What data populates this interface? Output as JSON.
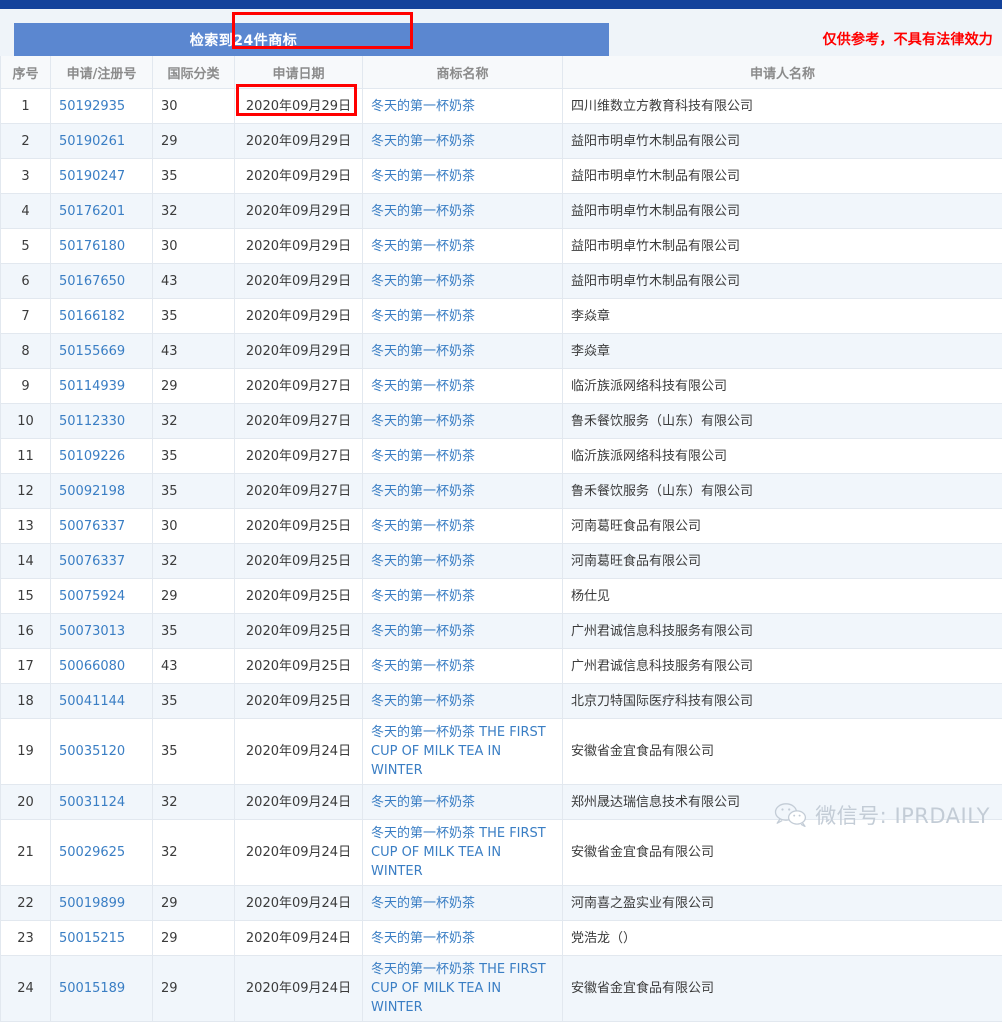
{
  "banner": {
    "count_text": "检索到24件商标",
    "disclaimer": "仅供参考，不具有法律效力",
    "bar_color": "#5b87d0",
    "disclaimer_color": "#ff0000",
    "highlight_color": "#ff0000"
  },
  "table": {
    "headers": {
      "seq": "序号",
      "number": "申请/注册号",
      "classification": "国际分类",
      "date": "申请日期",
      "trademark": "商标名称",
      "applicant": "申请人名称"
    },
    "rows": [
      {
        "seq": "1",
        "number": "50192935",
        "classification": "30",
        "date": "2020年09月29日",
        "trademark": "冬天的第一杯奶茶",
        "applicant": "四川维数立方教育科技有限公司"
      },
      {
        "seq": "2",
        "number": "50190261",
        "classification": "29",
        "date": "2020年09月29日",
        "trademark": "冬天的第一杯奶茶",
        "applicant": "益阳市明卓竹木制品有限公司"
      },
      {
        "seq": "3",
        "number": "50190247",
        "classification": "35",
        "date": "2020年09月29日",
        "trademark": "冬天的第一杯奶茶",
        "applicant": "益阳市明卓竹木制品有限公司"
      },
      {
        "seq": "4",
        "number": "50176201",
        "classification": "32",
        "date": "2020年09月29日",
        "trademark": "冬天的第一杯奶茶",
        "applicant": "益阳市明卓竹木制品有限公司"
      },
      {
        "seq": "5",
        "number": "50176180",
        "classification": "30",
        "date": "2020年09月29日",
        "trademark": "冬天的第一杯奶茶",
        "applicant": "益阳市明卓竹木制品有限公司"
      },
      {
        "seq": "6",
        "number": "50167650",
        "classification": "43",
        "date": "2020年09月29日",
        "trademark": "冬天的第一杯奶茶",
        "applicant": "益阳市明卓竹木制品有限公司"
      },
      {
        "seq": "7",
        "number": "50166182",
        "classification": "35",
        "date": "2020年09月29日",
        "trademark": "冬天的第一杯奶茶",
        "applicant": "李焱章"
      },
      {
        "seq": "8",
        "number": "50155669",
        "classification": "43",
        "date": "2020年09月29日",
        "trademark": "冬天的第一杯奶茶",
        "applicant": "李焱章"
      },
      {
        "seq": "9",
        "number": "50114939",
        "classification": "29",
        "date": "2020年09月27日",
        "trademark": "冬天的第一杯奶茶",
        "applicant": "临沂族派网络科技有限公司"
      },
      {
        "seq": "10",
        "number": "50112330",
        "classification": "32",
        "date": "2020年09月27日",
        "trademark": "冬天的第一杯奶茶",
        "applicant": "鲁禾餐饮服务（山东）有限公司"
      },
      {
        "seq": "11",
        "number": "50109226",
        "classification": "35",
        "date": "2020年09月27日",
        "trademark": "冬天的第一杯奶茶",
        "applicant": "临沂族派网络科技有限公司"
      },
      {
        "seq": "12",
        "number": "50092198",
        "classification": "35",
        "date": "2020年09月27日",
        "trademark": "冬天的第一杯奶茶",
        "applicant": "鲁禾餐饮服务（山东）有限公司"
      },
      {
        "seq": "13",
        "number": "50076337",
        "classification": "30",
        "date": "2020年09月25日",
        "trademark": "冬天的第一杯奶茶",
        "applicant": "河南葛旺食品有限公司"
      },
      {
        "seq": "14",
        "number": "50076337",
        "classification": "32",
        "date": "2020年09月25日",
        "trademark": "冬天的第一杯奶茶",
        "applicant": "河南葛旺食品有限公司"
      },
      {
        "seq": "15",
        "number": "50075924",
        "classification": "29",
        "date": "2020年09月25日",
        "trademark": "冬天的第一杯奶茶",
        "applicant": "杨仕见"
      },
      {
        "seq": "16",
        "number": "50073013",
        "classification": "35",
        "date": "2020年09月25日",
        "trademark": "冬天的第一杯奶茶",
        "applicant": "广州君诚信息科技服务有限公司"
      },
      {
        "seq": "17",
        "number": "50066080",
        "classification": "43",
        "date": "2020年09月25日",
        "trademark": "冬天的第一杯奶茶",
        "applicant": "广州君诚信息科技服务有限公司"
      },
      {
        "seq": "18",
        "number": "50041144",
        "classification": "35",
        "date": "2020年09月25日",
        "trademark": "冬天的第一杯奶茶",
        "applicant": "北京刀特国际医疗科技有限公司"
      },
      {
        "seq": "19",
        "number": "50035120",
        "classification": "35",
        "date": "2020年09月24日",
        "trademark": "冬天的第一杯奶茶 THE FIRST CUP OF MILK TEA IN WINTER",
        "applicant": "安徽省金宜食品有限公司"
      },
      {
        "seq": "20",
        "number": "50031124",
        "classification": "32",
        "date": "2020年09月24日",
        "trademark": "冬天的第一杯奶茶",
        "applicant": "郑州晟达瑞信息技术有限公司"
      },
      {
        "seq": "21",
        "number": "50029625",
        "classification": "32",
        "date": "2020年09月24日",
        "trademark": "冬天的第一杯奶茶 THE FIRST CUP OF MILK TEA IN WINTER",
        "applicant": "安徽省金宜食品有限公司"
      },
      {
        "seq": "22",
        "number": "50019899",
        "classification": "29",
        "date": "2020年09月24日",
        "trademark": "冬天的第一杯奶茶",
        "applicant": "河南喜之盈实业有限公司"
      },
      {
        "seq": "23",
        "number": "50015215",
        "classification": "29",
        "date": "2020年09月24日",
        "trademark": "冬天的第一杯奶茶",
        "applicant": "党浩龙（）"
      },
      {
        "seq": "24",
        "number": "50015189",
        "classification": "29",
        "date": "2020年09月24日",
        "trademark": "冬天的第一杯奶茶 THE FIRST CUP OF MILK TEA IN WINTER",
        "applicant": "安徽省金宜食品有限公司"
      }
    ]
  },
  "watermark": {
    "text": "微信号: IPRDAILY"
  }
}
